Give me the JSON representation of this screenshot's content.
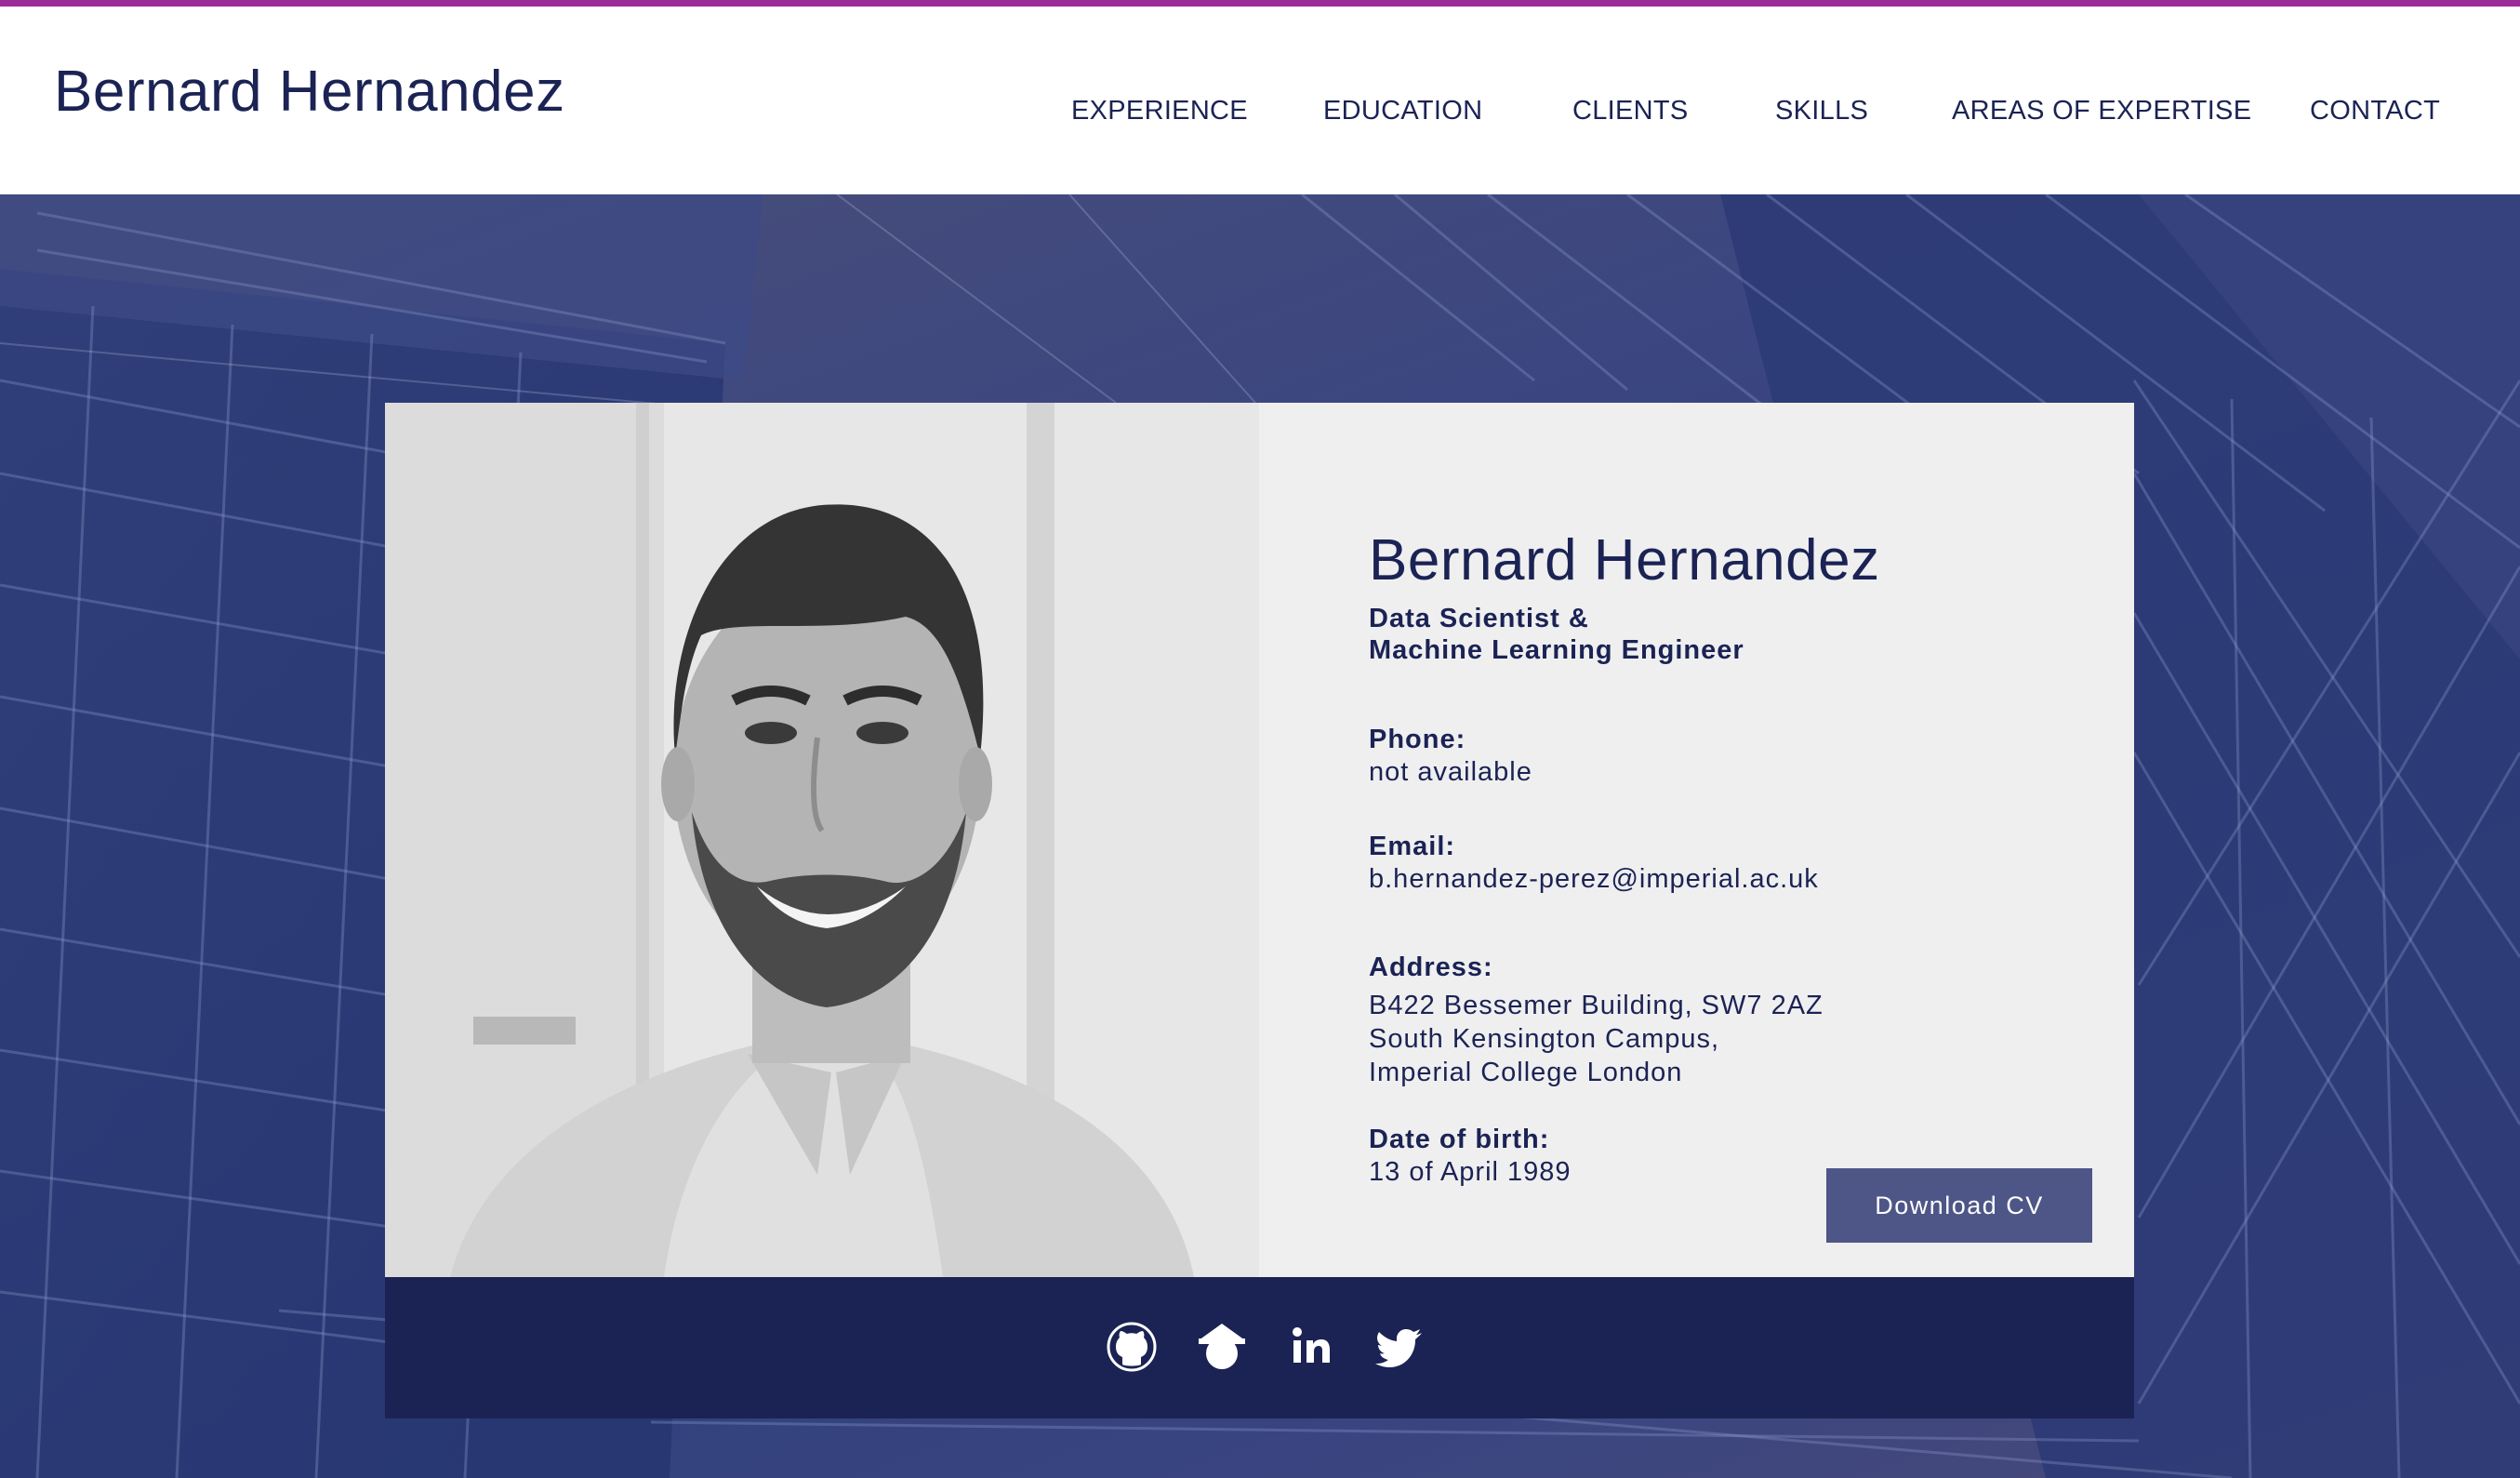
{
  "site": {
    "title": "Bernard Hernandez"
  },
  "nav": {
    "items": [
      {
        "label": "EXPERIENCE"
      },
      {
        "label": "EDUCATION"
      },
      {
        "label": "CLIENTS"
      },
      {
        "label": "SKILLS"
      },
      {
        "label": "AREAS OF EXPERTISE"
      },
      {
        "label": "CONTACT"
      }
    ]
  },
  "profile": {
    "name": "Bernard Hernandez",
    "role": "Data Scientist &\nMachine Learning Engineer",
    "phone_label": "Phone:",
    "phone": "not available",
    "email_label": "Email:",
    "email": "b.hernandez-perez@imperial.ac.uk",
    "address_label": "Address:",
    "address": "B422 Bessemer Building, SW7 2AZ\nSouth Kensington Campus,\nImperial College London",
    "dob_label": "Date of birth:",
    "dob": "13 of April 1989",
    "download_label": "Download CV"
  },
  "social": {
    "icons": [
      "github-icon",
      "google-scholar-icon",
      "linkedin-icon",
      "twitter-icon"
    ]
  },
  "colors": {
    "accent_line": "#9b2c98",
    "navy": "#1b2354",
    "button": "#4e5687",
    "card": "#efeff0"
  }
}
